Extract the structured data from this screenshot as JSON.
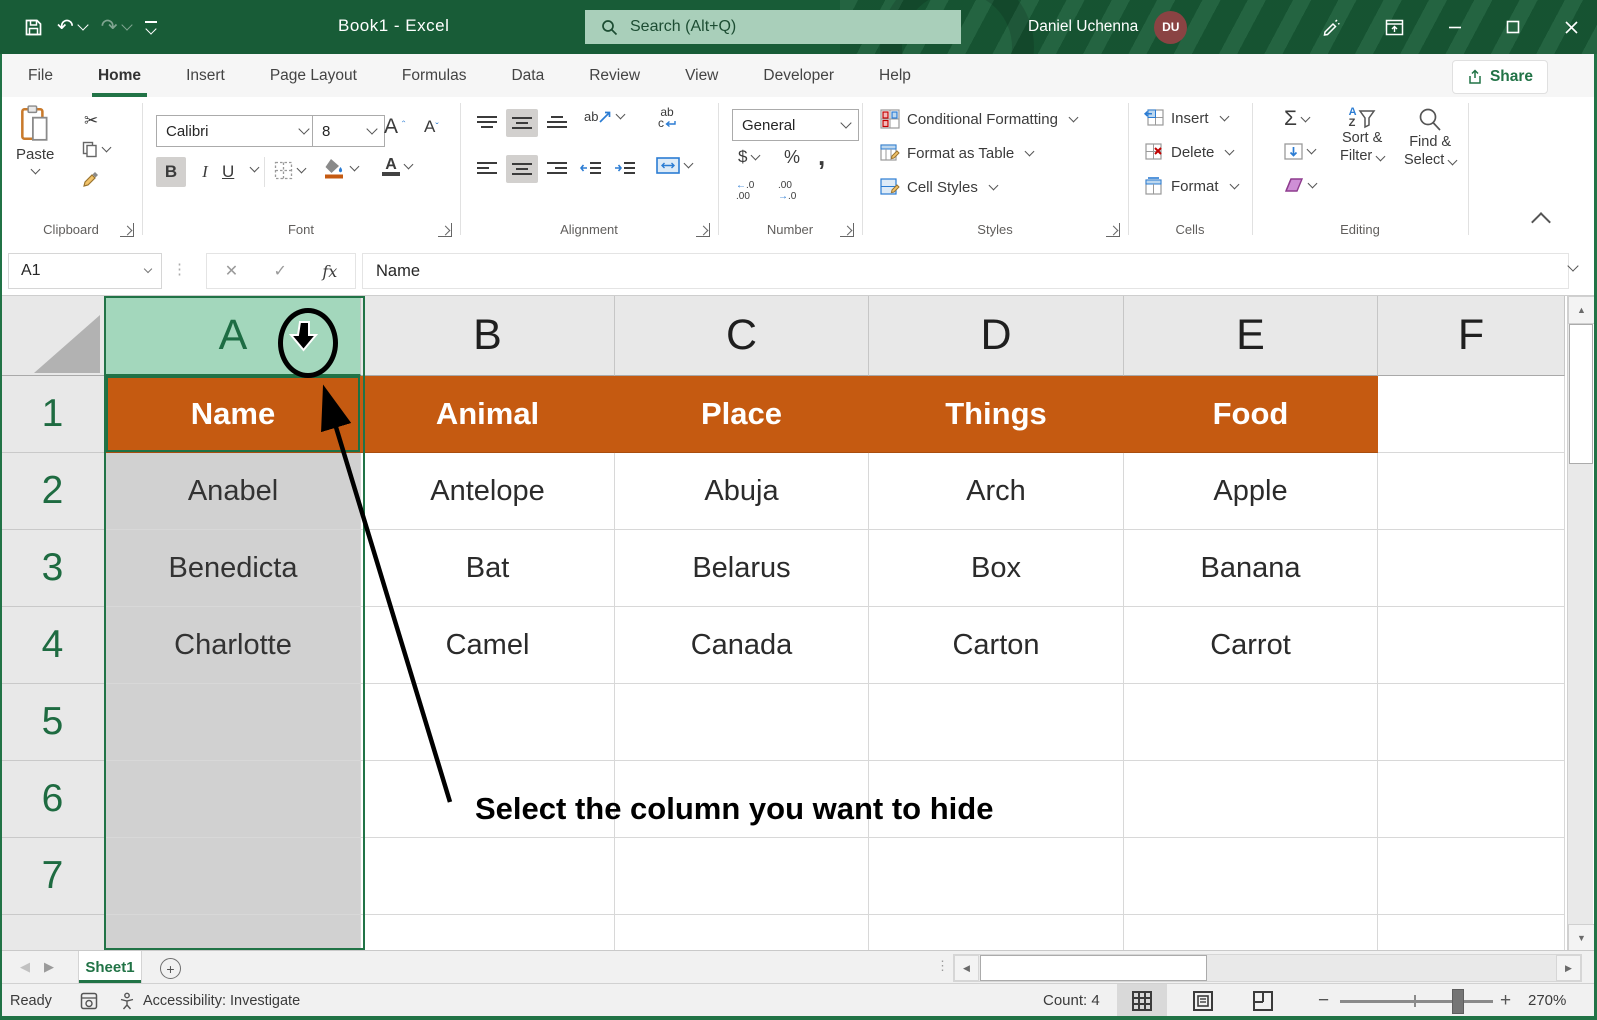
{
  "titlebar": {
    "title": "Book1 - Excel",
    "search_placeholder": "Search (Alt+Q)",
    "user_name": "Daniel Uchenna",
    "user_initials": "DU"
  },
  "tabs": {
    "items": [
      {
        "label": "File"
      },
      {
        "label": "Home"
      },
      {
        "label": "Insert"
      },
      {
        "label": "Page Layout"
      },
      {
        "label": "Formulas"
      },
      {
        "label": "Data"
      },
      {
        "label": "Review"
      },
      {
        "label": "View"
      },
      {
        "label": "Developer"
      },
      {
        "label": "Help"
      }
    ],
    "active": "Home",
    "share_label": "Share"
  },
  "ribbon": {
    "clipboard": {
      "paste": "Paste",
      "label": "Clipboard"
    },
    "font": {
      "family": "Calibri",
      "size": "8",
      "bold": "B",
      "italic": "I",
      "underline": "U",
      "grow": "A",
      "shrink": "A",
      "color_letter": "A",
      "label": "Font"
    },
    "alignment": {
      "orientation_glyph": "ab",
      "wrap_glyph_top": "ab",
      "wrap_glyph_bottom": "c",
      "label": "Alignment"
    },
    "number": {
      "format": "General",
      "currency": "$",
      "percent": "%",
      "comma": ",",
      "label": "Number"
    },
    "styles": {
      "conditional_formatting": "Conditional Formatting",
      "format_as_table": "Format as Table",
      "cell_styles": "Cell Styles",
      "label": "Styles"
    },
    "cells": {
      "insert": "Insert",
      "delete": "Delete",
      "format": "Format",
      "label": "Cells"
    },
    "editing": {
      "autosum_glyph": "Σ",
      "sort_a": "A",
      "sort_z": "Z",
      "sort_line1": "Sort &",
      "sort_line2": "Filter",
      "find_line1": "Find &",
      "find_line2": "Select",
      "label": "Editing"
    }
  },
  "formula_bar": {
    "cell_ref": "A1",
    "fx": "fx",
    "content": "Name"
  },
  "sheet": {
    "columns": [
      "A",
      "B",
      "C",
      "D",
      "E",
      "F"
    ],
    "selected_column": "A",
    "row_numbers": [
      "1",
      "2",
      "3",
      "4",
      "5",
      "6",
      "7"
    ],
    "table": {
      "header_row": [
        "Name",
        "Animal",
        "Place",
        "Things",
        "Food"
      ],
      "data_rows": [
        [
          "Anabel",
          "Antelope",
          "Abuja",
          "Arch",
          "Apple"
        ],
        [
          "Benedicta",
          "Bat",
          "Belarus",
          "Box",
          "Banana"
        ],
        [
          "Charlotte",
          "Camel",
          "Canada",
          "Carton",
          "Carrot"
        ]
      ]
    },
    "annotation": "Select the column you want to hide"
  },
  "sheet_tabs": {
    "active": "Sheet1"
  },
  "status_bar": {
    "mode": "Ready",
    "accessibility": "Accessibility: Investigate",
    "count": "Count: 4",
    "zoom_level": "270%"
  },
  "colors": {
    "excel_green": "#217346",
    "titlebar_green": "#185C37",
    "header_orange": "#C55A11",
    "selected_column_header": "#A3D7BC",
    "selected_cells_gray": "#D1D1D1"
  }
}
